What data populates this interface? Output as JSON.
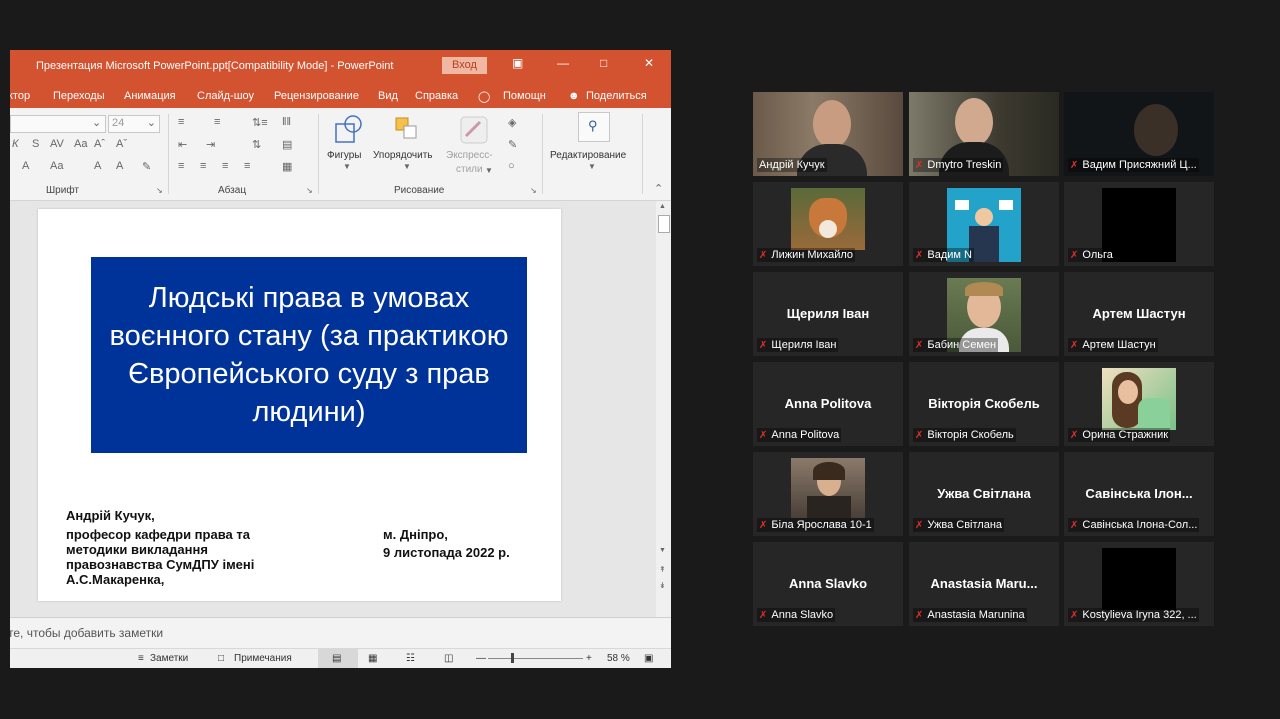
{
  "ppt": {
    "title": "Презентация Microsoft PowerPoint.ppt[Compatibility Mode]  -  PowerPoint",
    "login": "Вход",
    "menu": [
      "ктор",
      "Переходы",
      "Анимация",
      "Слайд-шоу",
      "Рецензирование",
      "Вид",
      "Справка",
      "Помощн",
      "Поделиться"
    ],
    "font_size": "24",
    "ribbon": {
      "shapes": "Фигуры",
      "arrange": "Упорядочить",
      "quick_styles_1": "Экспресс-",
      "quick_styles_2": "стили",
      "editing": "Редактирование",
      "group_font": "Шрифт",
      "group_paragraph": "Абзац",
      "group_drawing": "Рисование"
    },
    "slide": {
      "title": "Людські права в умовах воєнного стану (за практикою Європейського суду з прав людини)",
      "author": "Андрій Кучук,",
      "position": "професор кафедри права та методики викладання правознавства СумДПУ імені А.С.Макаренка,",
      "city": "м. Дніпро,",
      "date": "9 листопада 2022 р."
    },
    "notes_hint": "те, чтобы добавить заметки",
    "status": {
      "notes": "Заметки",
      "comments": "Примечания",
      "zoom": "58 %"
    }
  },
  "gallery": [
    {
      "name": "",
      "label": "Андрій Кучук",
      "active": true
    },
    {
      "name": "",
      "label": "Dmytro Treskin"
    },
    {
      "name": "",
      "label": "Вадим Присяжний Ц..."
    },
    {
      "name": "",
      "label": "Лижин Михайло"
    },
    {
      "name": "",
      "label": "Вадим N"
    },
    {
      "name": "",
      "label": "Ольга"
    },
    {
      "name": "Щериля Іван",
      "label": "Щериля Іван"
    },
    {
      "name": "",
      "label": "Бабин Семен"
    },
    {
      "name": "Артем Шастун",
      "label": "Артем Шастун"
    },
    {
      "name": "Anna Politova",
      "label": "Anna Politova"
    },
    {
      "name": "Вікторія Скобель",
      "label": "Вікторія Скобель"
    },
    {
      "name": "",
      "label": "Орина Стражник"
    },
    {
      "name": "",
      "label": "Біла Ярослава 10-1"
    },
    {
      "name": "Ужва Світлана",
      "label": "Ужва Світлана"
    },
    {
      "name": "Савінська Ілон...",
      "label": "Савінська Ілона-Сол..."
    },
    {
      "name": "Anna Slavko",
      "label": "Anna Slavko"
    },
    {
      "name": "Anastasia  Maru...",
      "label": "Anastasia Marunina"
    },
    {
      "name": "",
      "label": "Kostylieva Iryna 322, ..."
    }
  ]
}
